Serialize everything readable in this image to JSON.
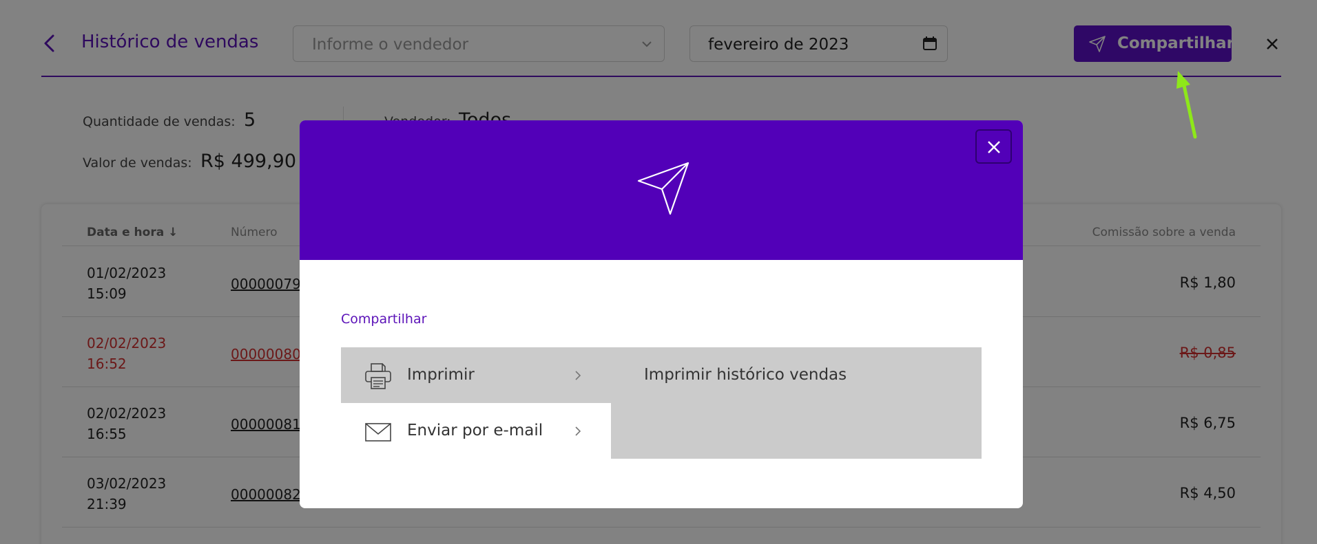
{
  "header": {
    "title": "Histórico de vendas",
    "seller_placeholder": "Informe o vendedor",
    "month_value": "fevereiro de 2023",
    "share_label": "Compartilhar"
  },
  "summary": {
    "qty_label": "Quantidade de vendas:",
    "qty_value": "5",
    "total_label": "Valor de vendas:",
    "total_value": "R$ 499,90",
    "seller_label": "Vendedor:",
    "seller_value": "Todos"
  },
  "table": {
    "columns": {
      "date": "Data e hora",
      "number": "Número",
      "commission": "Comissão sobre a venda"
    },
    "rows": [
      {
        "date": "01/02/2023\n15:09",
        "number": "00000079",
        "commission": "R$ 1,80",
        "canceled": false
      },
      {
        "date": "02/02/2023\n16:52",
        "number": "00000080",
        "commission": "R$ 0,85",
        "canceled": true
      },
      {
        "date": "02/02/2023\n16:55",
        "number": "00000081",
        "commission": "R$ 6,75",
        "canceled": false
      },
      {
        "date": "03/02/2023\n21:39",
        "number": "00000082",
        "commission": "R$ 4,50",
        "canceled": false
      }
    ]
  },
  "modal": {
    "section_title": "Compartilhar",
    "options": [
      {
        "label": "Imprimir",
        "icon": "printer-icon"
      },
      {
        "label": "Enviar por e-mail",
        "icon": "envelope-icon"
      }
    ],
    "detail_action": "Imprimir histórico vendas"
  },
  "colors": {
    "brand": "#5200b8",
    "accent_text": "#5b12b8",
    "canceled": "#d32f2f",
    "annotation_arrow": "#8ee81a"
  }
}
